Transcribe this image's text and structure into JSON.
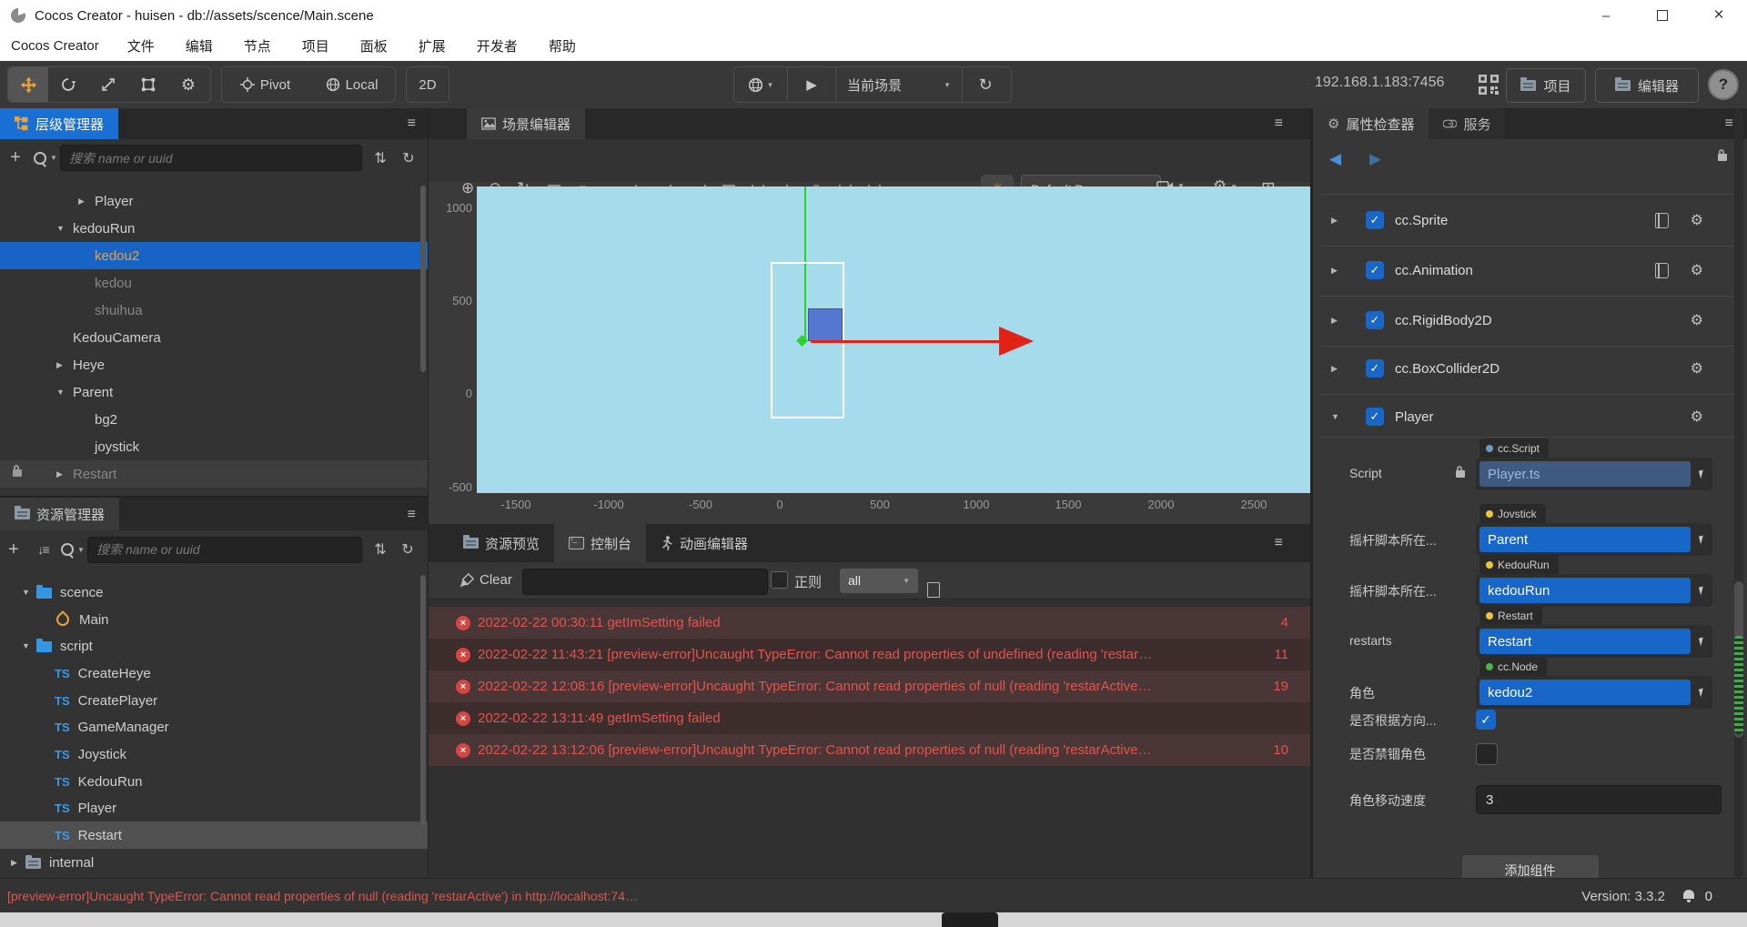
{
  "window": {
    "title": "Cocos Creator - huisen - db://assets/scence/Main.scene"
  },
  "menu": {
    "items": [
      "Cocos Creator",
      "文件",
      "编辑",
      "节点",
      "项目",
      "面板",
      "扩展",
      "开发者",
      "帮助"
    ]
  },
  "icons": {
    "play": "▶",
    "refresh": "↻",
    "dropdown": "▼",
    "back": "◀",
    "forward": "▶",
    "zoom_in": "⊕",
    "zoom_out": "⊖",
    "collapse": "⇅",
    "plus": "+",
    "grid": "⊞",
    "lamp": "☀",
    "gear": "⚙",
    "check": "✓",
    "close": "×",
    "minimize": "–",
    "hamburger": "≡",
    "sort": "↓≡"
  },
  "toolbar": {
    "pivot": "Pivot",
    "local": "Local",
    "mode2d": "2D",
    "scene_select": "当前场景",
    "ip": "192.168.1.183:7456",
    "project": "项目",
    "editor": "编辑器",
    "help": "?"
  },
  "hierarchy": {
    "tab": "层级管理器",
    "search_placeholder": "搜索 name or uuid",
    "nodes": [
      {
        "label": "Player",
        "indent": 2,
        "arrow": "right"
      },
      {
        "label": "kedouRun",
        "indent": 1,
        "arrow": "down"
      },
      {
        "label": "kedou2",
        "indent": 2,
        "arrow": "",
        "selected": true
      },
      {
        "label": "kedou",
        "indent": 2,
        "arrow": "",
        "dim": true
      },
      {
        "label": "shuihua",
        "indent": 2,
        "arrow": "",
        "dim": true
      },
      {
        "label": "KedouCamera",
        "indent": 1,
        "arrow": ""
      },
      {
        "label": "Heye",
        "indent": 1,
        "arrow": "right"
      },
      {
        "label": "Parent",
        "indent": 1,
        "arrow": "down"
      },
      {
        "label": "bg2",
        "indent": 2,
        "arrow": ""
      },
      {
        "label": "joystick",
        "indent": 2,
        "arrow": ""
      },
      {
        "label": "Restart",
        "indent": 1,
        "arrow": "right",
        "dim": true,
        "locked": true,
        "rowbg": true
      }
    ]
  },
  "assets": {
    "tab": "资源管理器",
    "search_placeholder": "搜索 name or uuid",
    "nodes": [
      {
        "label": "scence",
        "indent": 1,
        "arrow": "down",
        "icon": "folder"
      },
      {
        "label": "Main",
        "indent": 2,
        "arrow": "",
        "icon": "scene"
      },
      {
        "label": "script",
        "indent": 1,
        "arrow": "down",
        "icon": "folder"
      },
      {
        "label": "CreateHeye",
        "indent": 2,
        "arrow": "",
        "icon": "ts"
      },
      {
        "label": "CreatePlayer",
        "indent": 2,
        "arrow": "",
        "icon": "ts"
      },
      {
        "label": "GameManager",
        "indent": 2,
        "arrow": "",
        "icon": "ts"
      },
      {
        "label": "Joystick",
        "indent": 2,
        "arrow": "",
        "icon": "ts"
      },
      {
        "label": "KedouRun",
        "indent": 2,
        "arrow": "",
        "icon": "ts"
      },
      {
        "label": "Player",
        "indent": 2,
        "arrow": "",
        "icon": "ts"
      },
      {
        "label": "Restart",
        "indent": 2,
        "arrow": "",
        "icon": "ts",
        "selected": true
      },
      {
        "label": "internal",
        "indent": 0,
        "arrow": "right",
        "icon": "folder-db"
      }
    ]
  },
  "scene": {
    "tab": "场景编辑器",
    "renderer_dropdown": "Default De...",
    "y_ticks": [
      "1000",
      "500",
      "0",
      "-500"
    ],
    "x_ticks": [
      "-1500",
      "-1000",
      "-500",
      "0",
      "500",
      "1000",
      "1500",
      "2000",
      "2500"
    ]
  },
  "console": {
    "tabs": [
      "资源预览",
      "控制台",
      "动画编辑器"
    ],
    "active_tab": "控制台",
    "clear": "Clear",
    "filter_value": "",
    "regex_label": "正则",
    "level_filter": "all",
    "rows": [
      {
        "text": "2022-02-22 00:30:11 getImSetting failed",
        "count": "4"
      },
      {
        "text": "2022-02-22 11:43:21 [preview-error]Uncaught TypeError: Cannot read properties of undefined (reading 'restar…",
        "count": "11"
      },
      {
        "text": "2022-02-22 12:08:16 [preview-error]Uncaught TypeError: Cannot read properties of null (reading 'restarActive…",
        "count": "19"
      },
      {
        "text": "2022-02-22 13:11:49 getImSetting failed",
        "count": ""
      },
      {
        "text": "2022-02-22 13:12:06 [preview-error]Uncaught TypeError: Cannot read properties of null (reading 'restarActive…",
        "count": "10"
      }
    ]
  },
  "inspector": {
    "tabs": [
      "属性检查器",
      "服务"
    ],
    "components": [
      {
        "name": "cc.Sprite",
        "book": true,
        "expanded": false
      },
      {
        "name": "cc.Animation",
        "book": true,
        "expanded": false
      },
      {
        "name": "cc.RigidBody2D",
        "book": false,
        "expanded": false
      },
      {
        "name": "cc.BoxCollider2D",
        "book": false,
        "expanded": false
      },
      {
        "name": "Player",
        "book": false,
        "expanded": true
      }
    ],
    "properties": [
      {
        "label": "Script",
        "type": "ref",
        "locked": true,
        "chip": "cc.Script",
        "chip_dot": "#6a9bc3",
        "value": "Player.ts",
        "muted": true
      },
      {
        "label": "摇杆脚本所在...",
        "type": "ref",
        "chip": "Jovstick",
        "chip_dot": "#e8c53d",
        "value": "Parent"
      },
      {
        "label": "摇杆脚本所在...",
        "type": "ref",
        "chip": "KedouRun",
        "chip_dot": "#e8c53d",
        "value": "kedouRun"
      },
      {
        "label": "restarts",
        "type": "ref",
        "chip": "Restart",
        "chip_dot": "#e8c53d",
        "value": "Restart"
      },
      {
        "label": "角色",
        "type": "ref",
        "chip": "cc.Node",
        "chip_dot": "#48b748",
        "value": "kedou2"
      },
      {
        "label": "是否根据方向...",
        "type": "checkbox",
        "checked": true
      },
      {
        "label": "是否禁锢角色",
        "type": "checkbox",
        "checked": false
      },
      {
        "label": "角色移动速度",
        "type": "input",
        "value": "3"
      }
    ],
    "add_component": "添加组件"
  },
  "statusbar": {
    "error": "[preview-error]Uncaught TypeError: Cannot read properties of null (reading 'restarActive') in http://localhost:74…",
    "version": "Version: 3.3.2",
    "notifications": "0"
  }
}
